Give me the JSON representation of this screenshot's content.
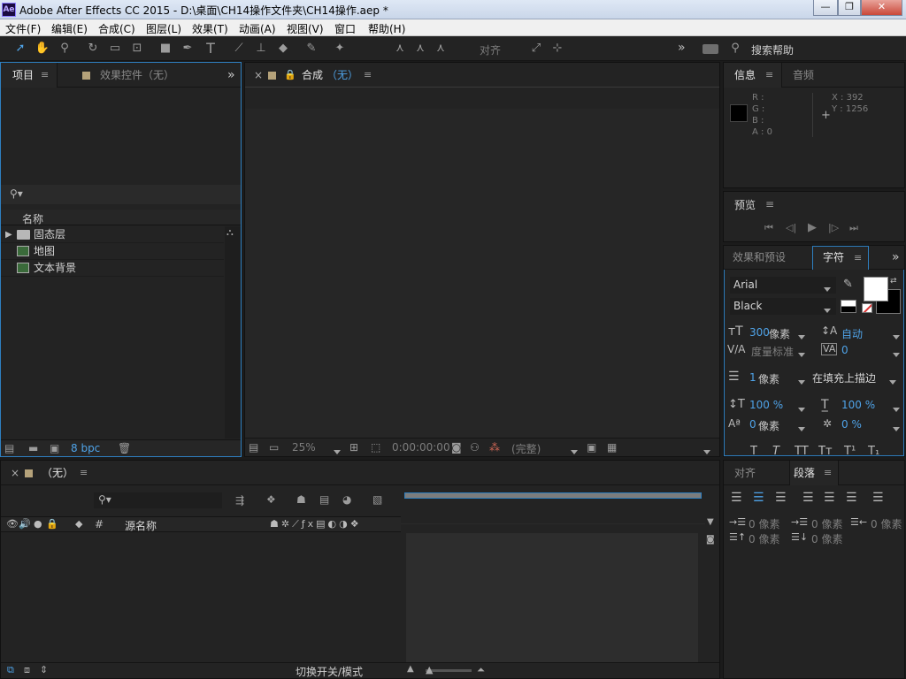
{
  "title_bar": {
    "app_logo": "Ae",
    "title": "Adobe After Effects CC 2015 - D:\\桌面\\CH14操作文件夹\\CH14操作.aep *",
    "minimize": "—",
    "restore": "❐",
    "close": "✕"
  },
  "menu": [
    "文件(F)",
    "编辑(E)",
    "合成(C)",
    "图层(L)",
    "效果(T)",
    "动画(A)",
    "视图(V)",
    "窗口",
    "帮助(H)"
  ],
  "toolbar": {
    "snap_label": "对齐",
    "overflow": "»",
    "search_placeholder": "搜索帮助"
  },
  "project_panel": {
    "tab_project": "项目",
    "tab_effects": "效果控件（无）",
    "overflow": "»",
    "column_name": "名称",
    "items": [
      {
        "name": "固态层",
        "type": "folder"
      },
      {
        "name": "地图",
        "type": "footage"
      },
      {
        "name": "文本背景",
        "type": "footage"
      }
    ],
    "bpc": "8 bpc"
  },
  "comp_panel": {
    "tab_label": "合成",
    "tab_value": "（无）",
    "zoom": "25%",
    "timecode": "0:00:00:00",
    "quality": "(完整)"
  },
  "info_panel": {
    "tab_info": "信息",
    "tab_audio": "音频",
    "r": "R :",
    "g": "G :",
    "b": "B :",
    "a": "A : 0",
    "x": "X : 392",
    "y": "Y : 1256",
    "swatch_color": "#000000"
  },
  "preview_panel": {
    "tab": "预览"
  },
  "character_panel": {
    "tab_effects": "效果和预设",
    "tab_character": "字符",
    "overflow": "»",
    "font": "Arial",
    "style": "Black",
    "font_size": "300",
    "font_size_unit": "像素",
    "leading": "自动",
    "kerning": "度量标准",
    "tracking": "0",
    "stroke_width": "1",
    "stroke_unit": "像素",
    "stroke_mode": "在填充上描边",
    "vscale": "100 %",
    "hscale": "100 %",
    "baseline": "0",
    "baseline_unit": "像素",
    "tsume": "0 %",
    "fill_color": "#ffffff",
    "stroke_color": "#000000"
  },
  "paragraph_panel": {
    "tab_align": "对齐",
    "tab_paragraph": "段落",
    "indent_left": "0 像素",
    "indent_first": "0 像素",
    "indent_right": "0 像素",
    "space_before": "0 像素",
    "space_after": "0 像素"
  },
  "timeline_panel": {
    "tab_value": "（无）",
    "column_source": "源名称",
    "column_hash": "#",
    "toggle_label": "切换开关/模式"
  }
}
